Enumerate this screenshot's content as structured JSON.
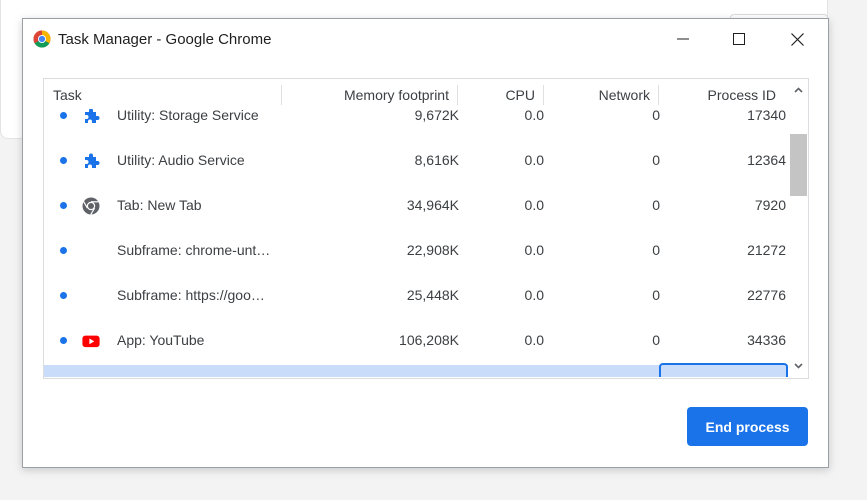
{
  "window": {
    "title": "Task Manager - Google Chrome",
    "controls": {
      "minimize": "minimize-icon",
      "maximize": "maximize-icon",
      "close": "close-icon"
    }
  },
  "table": {
    "columns": {
      "task": "Task",
      "memory": "Memory footprint",
      "cpu": "CPU",
      "network": "Network",
      "pid": "Process ID"
    },
    "rows": [
      {
        "icon": "puzzle-icon",
        "task": "Utility: Storage Service",
        "memory": "9,672K",
        "cpu": "0.0",
        "network": "0",
        "pid": "17340"
      },
      {
        "icon": "puzzle-icon",
        "task": "Utility: Audio Service",
        "memory": "8,616K",
        "cpu": "0.0",
        "network": "0",
        "pid": "12364"
      },
      {
        "icon": "chrome-icon",
        "task": "Tab: New Tab",
        "memory": "34,964K",
        "cpu": "0.0",
        "network": "0",
        "pid": "7920"
      },
      {
        "icon": "",
        "task": "Subframe: chrome-unt…",
        "memory": "22,908K",
        "cpu": "0.0",
        "network": "0",
        "pid": "21272"
      },
      {
        "icon": "",
        "task": "Subframe: https://goo…",
        "memory": "25,448K",
        "cpu": "0.0",
        "network": "0",
        "pid": "22776"
      },
      {
        "icon": "youtube-icon",
        "task": "App: YouTube",
        "memory": "106,208K",
        "cpu": "0.0",
        "network": "0",
        "pid": "34336"
      }
    ]
  },
  "actions": {
    "end_process": "End process"
  },
  "colors": {
    "accent": "#1a73e8",
    "selection": "#c9ddfb",
    "puzzle": "#1a73e8",
    "youtube": "#ff0000"
  }
}
